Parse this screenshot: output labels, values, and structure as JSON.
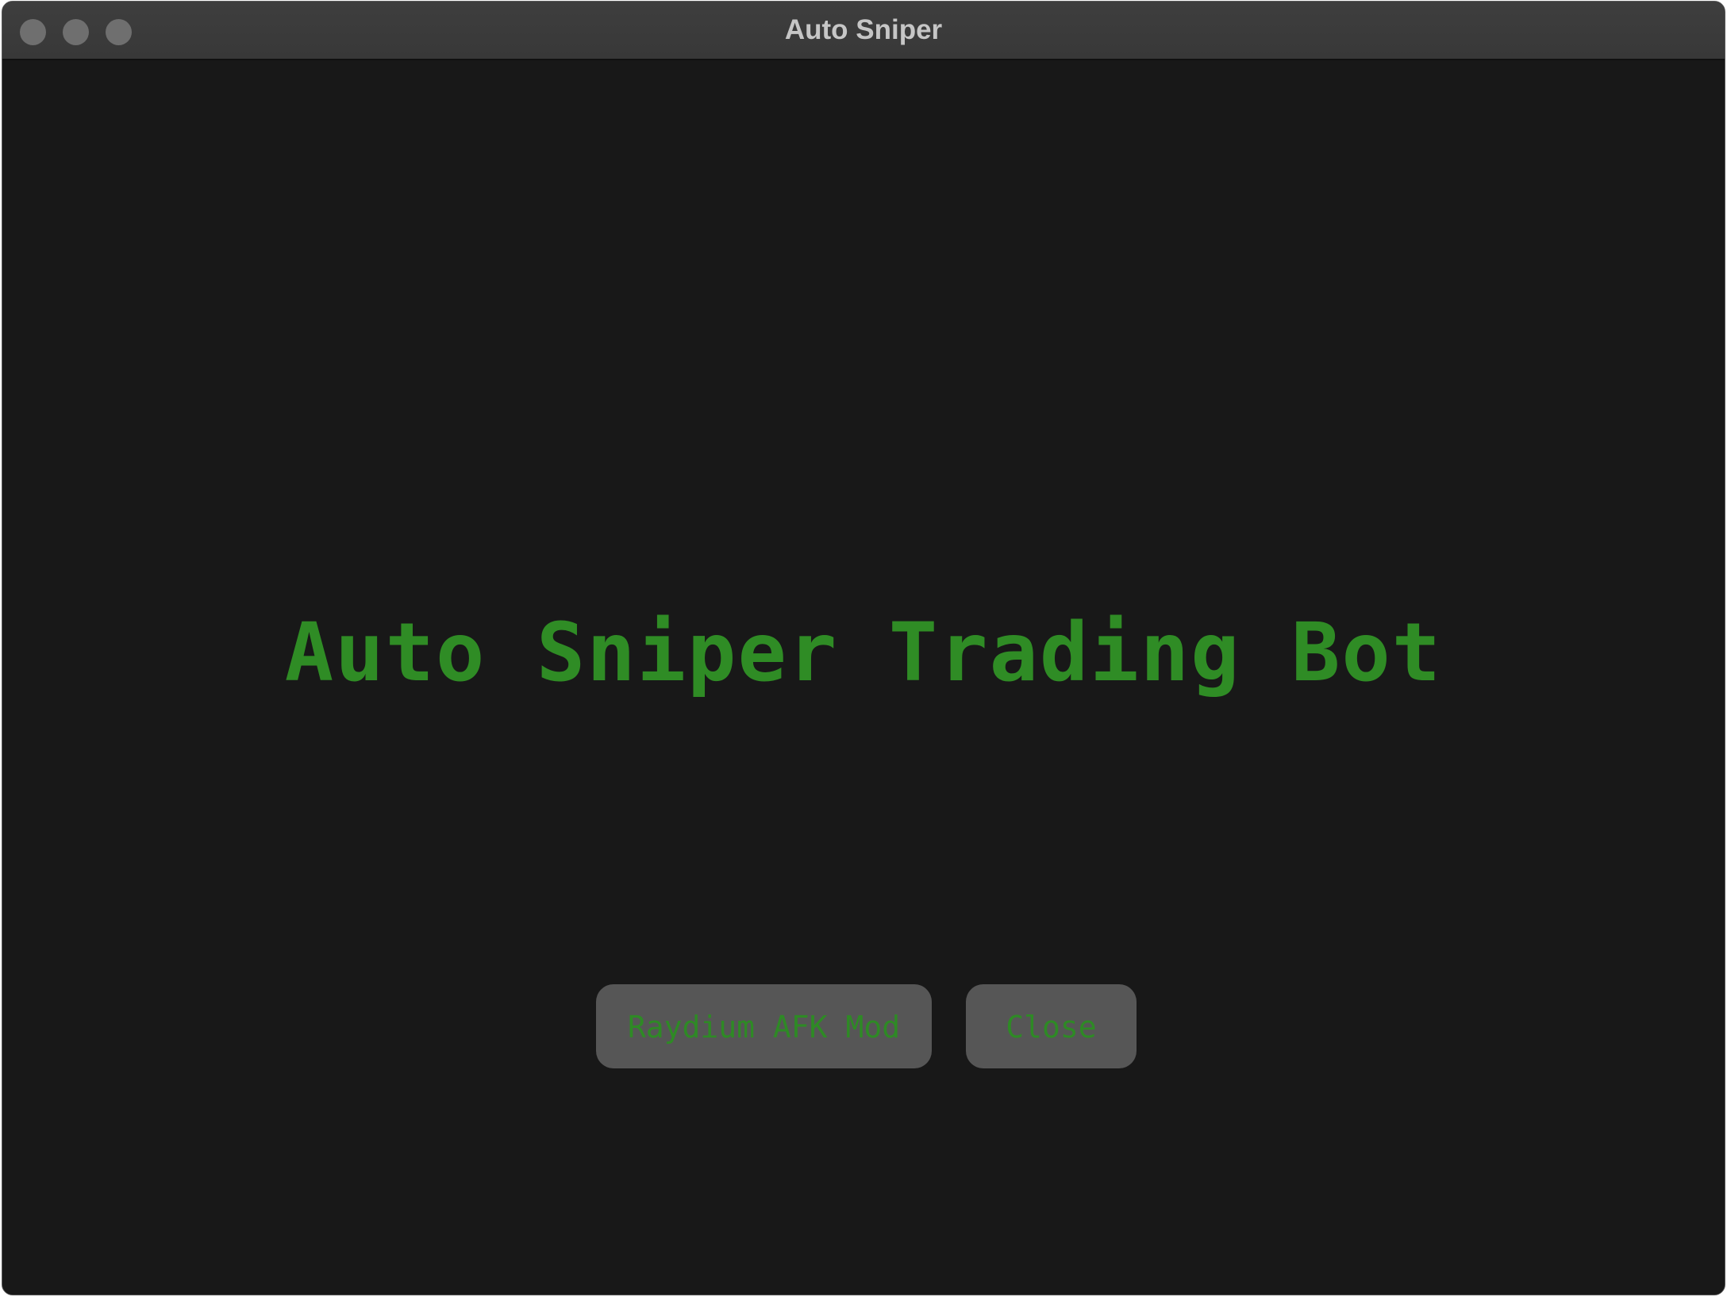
{
  "window": {
    "title": "Auto Sniper",
    "controls": [
      "close",
      "minimize",
      "zoom"
    ]
  },
  "main": {
    "headline": "Auto Sniper Trading Bot",
    "buttons": [
      {
        "label": "Raydium AFK Mod"
      },
      {
        "label": "Close"
      }
    ]
  },
  "colors": {
    "background": "#181818",
    "accent_green": "#2f8c25",
    "button_bg": "#565656",
    "titlebar": "#3a3a3a"
  }
}
